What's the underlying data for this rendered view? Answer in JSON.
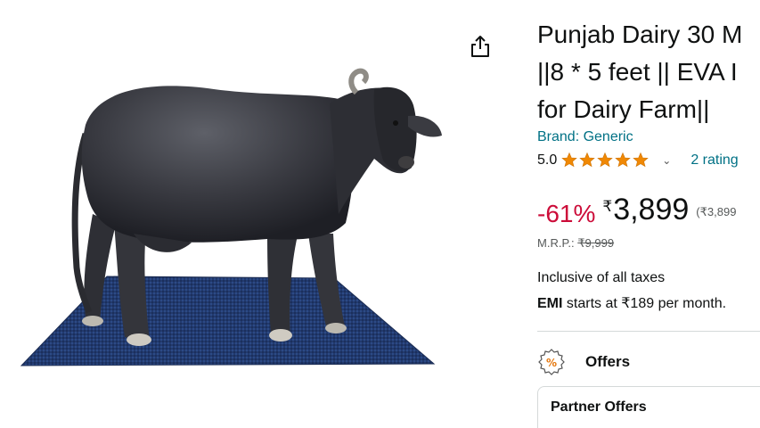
{
  "product": {
    "title_lines": [
      "Punjab Dairy 30 M",
      "||8 * 5 feet || EVA I",
      "for Dairy Farm||"
    ],
    "brand": "Brand: Generic",
    "rating": "5.0",
    "rating_value": 5,
    "rating_count": "2 rating",
    "discount": "-61%",
    "currency": "₹",
    "price": "3,899",
    "per_unit": "(₹3,899",
    "mrp_label": "M.R.P.: ",
    "mrp_value": "₹9,999",
    "taxes": "Inclusive of all taxes",
    "emi_bold": "EMI",
    "emi_rest": " starts at ₹189 per month."
  },
  "offers": {
    "label": "Offers",
    "icon": "percent-badge-icon"
  },
  "partner": {
    "label": "Partner Offers"
  },
  "image": {
    "alt": "black buffalo standing on blue mat"
  },
  "colors": {
    "link": "#007185",
    "discount": "#cc0c39",
    "star": "#f08804"
  }
}
